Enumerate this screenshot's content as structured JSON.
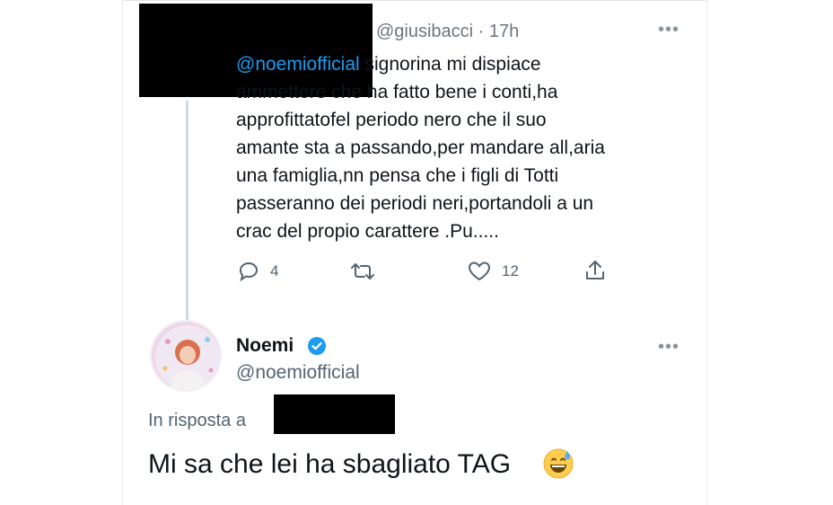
{
  "colors": {
    "accent": "#1d9bf0",
    "muted": "#536471",
    "text": "#0f1419",
    "redaction": "#000000"
  },
  "tweet1": {
    "handle_time": "@giusibacci · 17h",
    "more_icon": "more-horizontal-icon",
    "mention": "@noemiofficial",
    "text_lines": [
      "signorina mi dispiace",
      "ammettere che ha fatto bene i conti,ha",
      "approfittatofel periodo nero che il suo",
      "amante sta a passando,per mandare all,aria",
      "una famiglia,nn pensa che i figli di Totti",
      "passeranno dei periodi neri,portandoli a un",
      "crac del propio carattere .Pu....."
    ],
    "actions": {
      "reply_icon": "reply-icon",
      "reply_count": "4",
      "retweet_icon": "retweet-icon",
      "like_icon": "heart-icon",
      "like_count": "12",
      "share_icon": "share-icon"
    }
  },
  "tweet2": {
    "name": "Noemi",
    "verified_icon": "verified-badge-icon",
    "handle": "@noemiofficial",
    "reply_to_label": "In risposta a",
    "text": "Mi sa che lei ha sbagliato TAG",
    "emoji_icon": "grinning-sweat-emoji-icon",
    "more_icon": "more-horizontal-icon"
  }
}
